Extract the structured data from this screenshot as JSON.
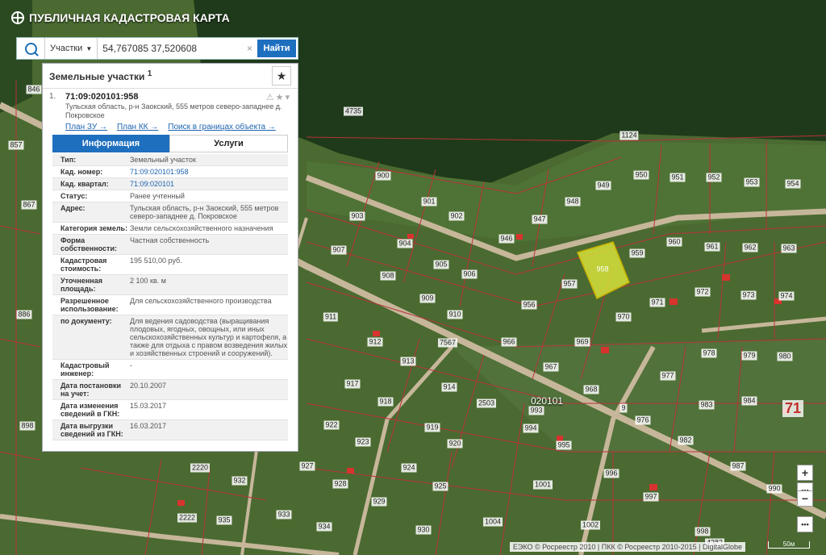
{
  "app": {
    "title": "ПУБЛИЧНАЯ КАДАСТРОВАЯ КАРТА"
  },
  "search": {
    "type_label": "Участки",
    "query": "54,767085 37,520608",
    "find_label": "Найти"
  },
  "panel": {
    "title": "Земельные участки",
    "count_sup": "1",
    "result": {
      "index": "1.",
      "cad_number": "71:09:020101:958",
      "address": "Тульская область, р-н Заокский, 555 метров северо-западнее д. Покровское",
      "links": [
        "План ЗУ →",
        "План КК →",
        "Поиск в границах объекта →"
      ]
    },
    "tabs": [
      "Информация",
      "Услуги"
    ],
    "attributes": [
      {
        "k": "Тип:",
        "v": "Земельный участок"
      },
      {
        "k": "Кад. номер:",
        "v": "71:09:020101:958",
        "link": true
      },
      {
        "k": "Кад. квартал:",
        "v": "71:09:020101",
        "link": true
      },
      {
        "k": "Статус:",
        "v": "Ранее учтенный"
      },
      {
        "k": "Адрес:",
        "v": "Тульская область, р-н Заокский, 555 метров северо-западнее д. Покровское"
      },
      {
        "k": "Категория земель:",
        "v": "Земли сельскохозяйственного назначения"
      },
      {
        "k": "Форма собственности:",
        "v": "Частная собственность"
      },
      {
        "k": "Кадастровая стоимость:",
        "v": "195 510,00 руб."
      },
      {
        "k": "Уточненная площадь:",
        "v": "2 100 кв. м"
      },
      {
        "k": "Разрешенное использование:",
        "v": "Для сельскохозяйственного производства"
      },
      {
        "k": "по документу:",
        "v": "Для ведения садоводства (выращивания плодовых, ягодных, овощных, или иных сельскохозяйственных культур и картофеля, а также для отдыха с правом возведения жилых и хозяйственных строений и сооружений)."
      },
      {
        "k": "Кадастровый инженер:",
        "v": "-"
      },
      {
        "k": "Дата постановки на учет:",
        "v": "20.10.2007"
      },
      {
        "k": "Дата изменения сведений в ГКН:",
        "v": "15.03.2017"
      },
      {
        "k": "Дата выгрузки сведений из ГКН:",
        "v": "16.03.2017"
      }
    ]
  },
  "map": {
    "quarter_label": "020101",
    "region_label": "71",
    "selected_parcel": "958",
    "parcels": [
      "900",
      "901",
      "902",
      "903",
      "904",
      "905",
      "906",
      "907",
      "908",
      "909",
      "910",
      "911",
      "912",
      "913",
      "914",
      "917",
      "918",
      "919",
      "920",
      "922",
      "923",
      "924",
      "925",
      "927",
      "928",
      "929",
      "930",
      "932",
      "933",
      "934",
      "935",
      "946",
      "947",
      "948",
      "949",
      "950",
      "951",
      "952",
      "953",
      "954",
      "956",
      "957",
      "958",
      "959",
      "960",
      "961",
      "962",
      "963",
      "966",
      "967",
      "968",
      "969",
      "970",
      "971",
      "972",
      "973",
      "974",
      "976",
      "977",
      "978",
      "979",
      "980",
      "982",
      "983",
      "984",
      "987",
      "990",
      "993",
      "994",
      "995",
      "996",
      "997",
      "998",
      "1001",
      "1002",
      "1004",
      "1124",
      "2220",
      "2222",
      "2503",
      "4735",
      "4382",
      "7567",
      "857",
      "846",
      "867",
      "886",
      "898",
      "9"
    ],
    "attribution": "ЕЭКО © Росреестр 2010 | ПКК © Росреестр 2010-2015 | DigitalGlobe",
    "scale": "50м",
    "colors": {
      "forest": "#1f3a1a",
      "field": "#4b6b33",
      "boundary": "#b8323a",
      "selected": "#d6e03a"
    }
  }
}
